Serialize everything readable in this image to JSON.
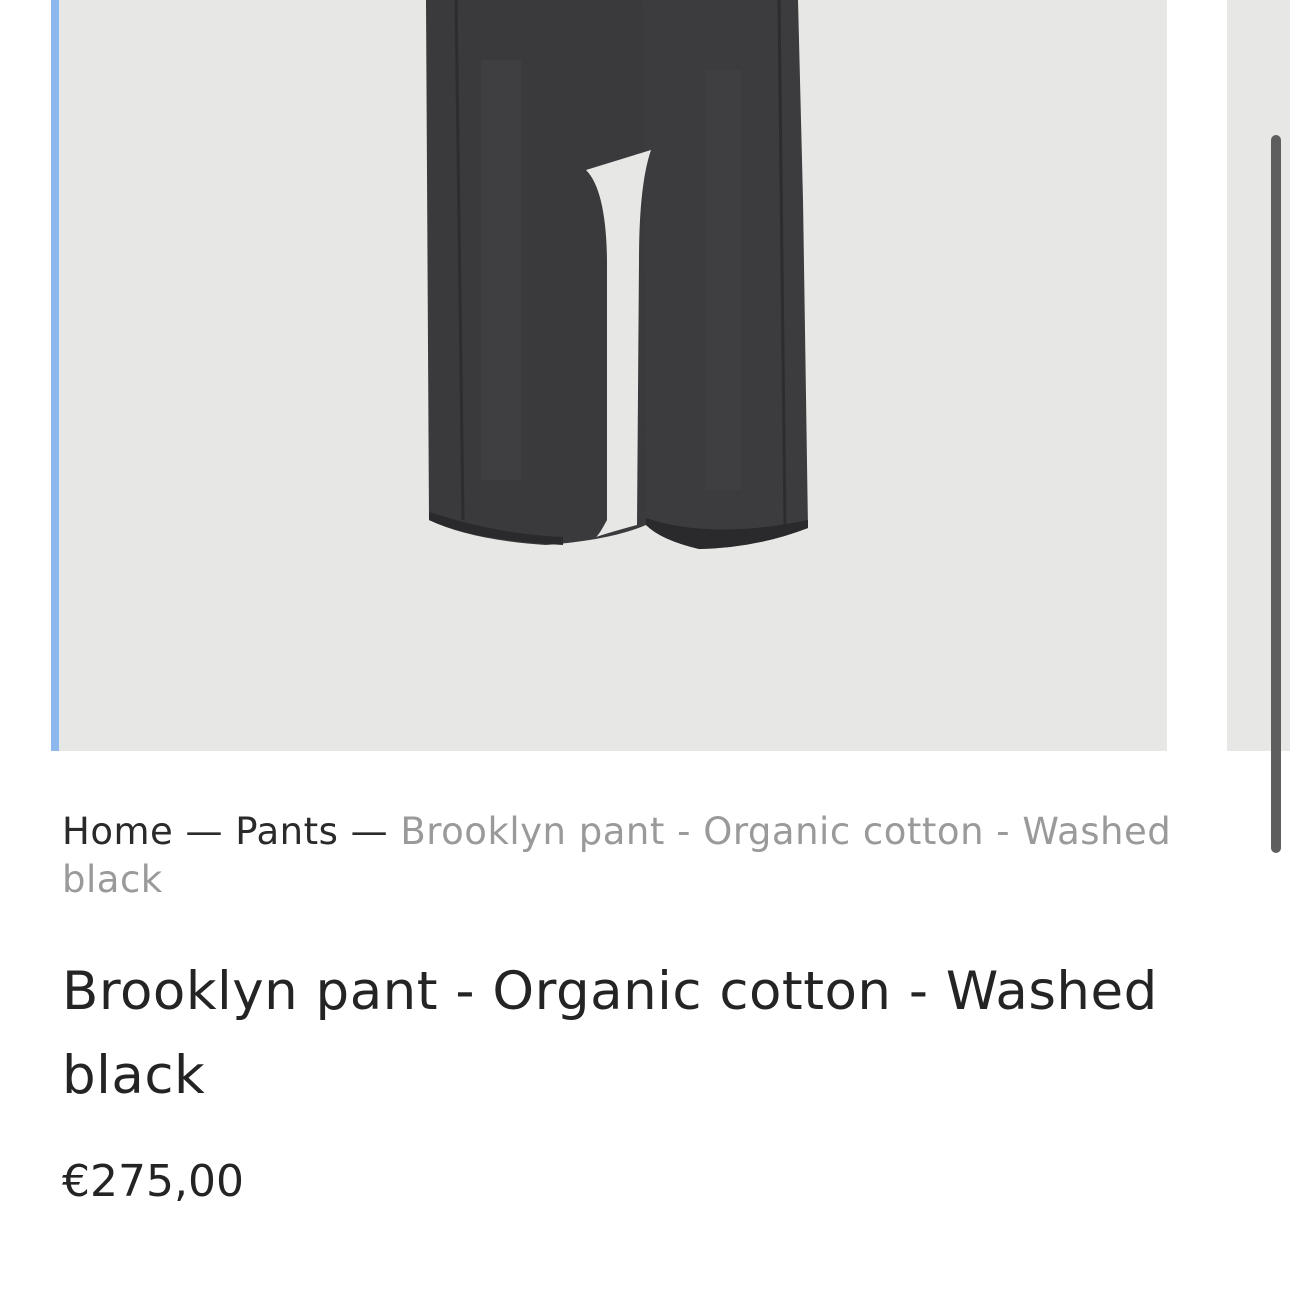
{
  "breadcrumb": {
    "home": "Home",
    "separator": "—",
    "category": "Pants",
    "current": "Brooklyn pant - Organic cotton - Washed black"
  },
  "product": {
    "title": "Brooklyn pant - Organic cotton - Washed black",
    "price": "€275,00",
    "image_subject": "black-wide-leg-jeans"
  },
  "colors": {
    "gallery_background": "#e7e7e5",
    "focus_indicator": "#8db8ee",
    "text": "#242424",
    "muted_text": "#9a9a9a"
  }
}
